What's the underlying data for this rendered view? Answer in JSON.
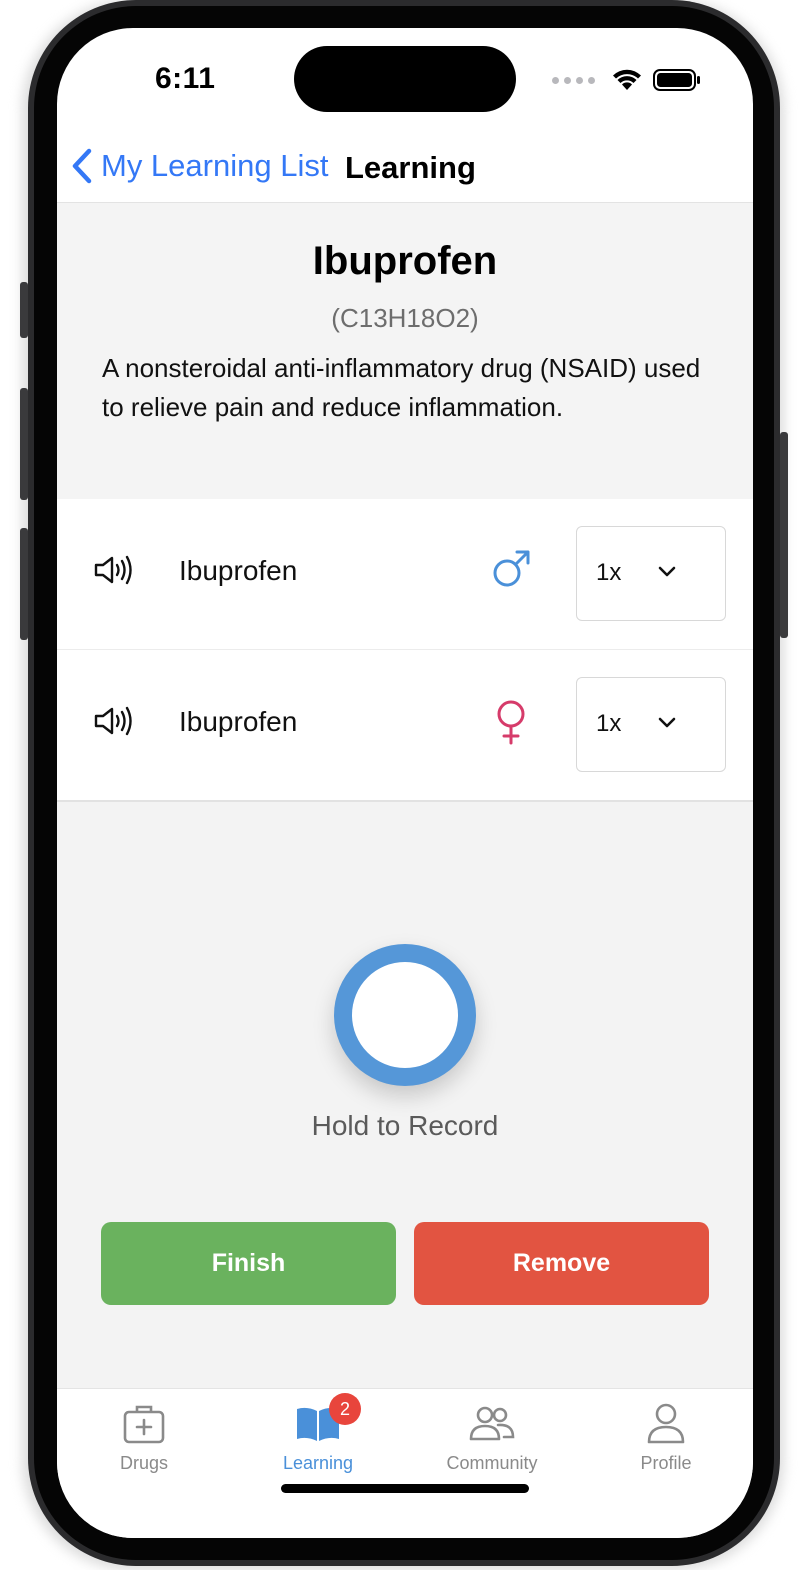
{
  "status_bar": {
    "time": "6:11"
  },
  "nav": {
    "back_label": "My Learning List",
    "title": "Learning"
  },
  "drug": {
    "name": "Ibuprofen",
    "formula": "(C13H18O2)",
    "description": "A nonsteroidal anti-inflammatory drug (NSAID) used to relieve pain and reduce inflammation."
  },
  "pronunciations": [
    {
      "label": "Ibuprofen",
      "voice": "male",
      "speed": "1x",
      "color": "#4a90d9"
    },
    {
      "label": "Ibuprofen",
      "voice": "female",
      "speed": "1x",
      "color": "#d63b6a"
    }
  ],
  "recorder": {
    "label": "Hold to Record",
    "color": "#5597d8"
  },
  "actions": {
    "finish_label": "Finish",
    "finish_color": "#6ab25e",
    "remove_label": "Remove",
    "remove_color": "#e25441"
  },
  "tabs": [
    {
      "label": "Drugs",
      "icon": "medical-kit-icon"
    },
    {
      "label": "Learning",
      "icon": "book-icon",
      "badge": "2",
      "active": true
    },
    {
      "label": "Community",
      "icon": "people-icon"
    },
    {
      "label": "Profile",
      "icon": "person-icon"
    }
  ]
}
